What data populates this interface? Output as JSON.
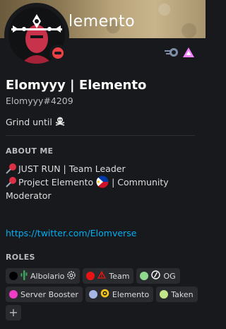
{
  "banner": {
    "text": "lemento"
  },
  "profile": {
    "display_name": "Elomyyy | Elemento",
    "tag": "Elomyyy#4209",
    "status": "dnd",
    "custom_status": "Grind until"
  },
  "about": {
    "title": "ABOUT ME",
    "line1": "JUST RUN | Team Leader",
    "line2": "Project Elemento",
    "line2b": "| Community",
    "line3": "Moderator",
    "link": "https://twitter.com/Elomverse"
  },
  "roles": {
    "title": "ROLES",
    "items": [
      {
        "label": "Albolario",
        "color": "#000000"
      },
      {
        "label": "Team",
        "color": "#e81414"
      },
      {
        "label": "OG",
        "color": "#8fd98f"
      },
      {
        "label": "Server Booster",
        "color": "#f03cc6"
      },
      {
        "label": "Elemento",
        "color": "#a9b7e6"
      },
      {
        "label": "Taken",
        "color": "#c4e68a"
      }
    ],
    "add_label": "+"
  },
  "colors": {
    "background": "#18191c",
    "link": "#00aff4",
    "dnd": "#ed4245"
  }
}
